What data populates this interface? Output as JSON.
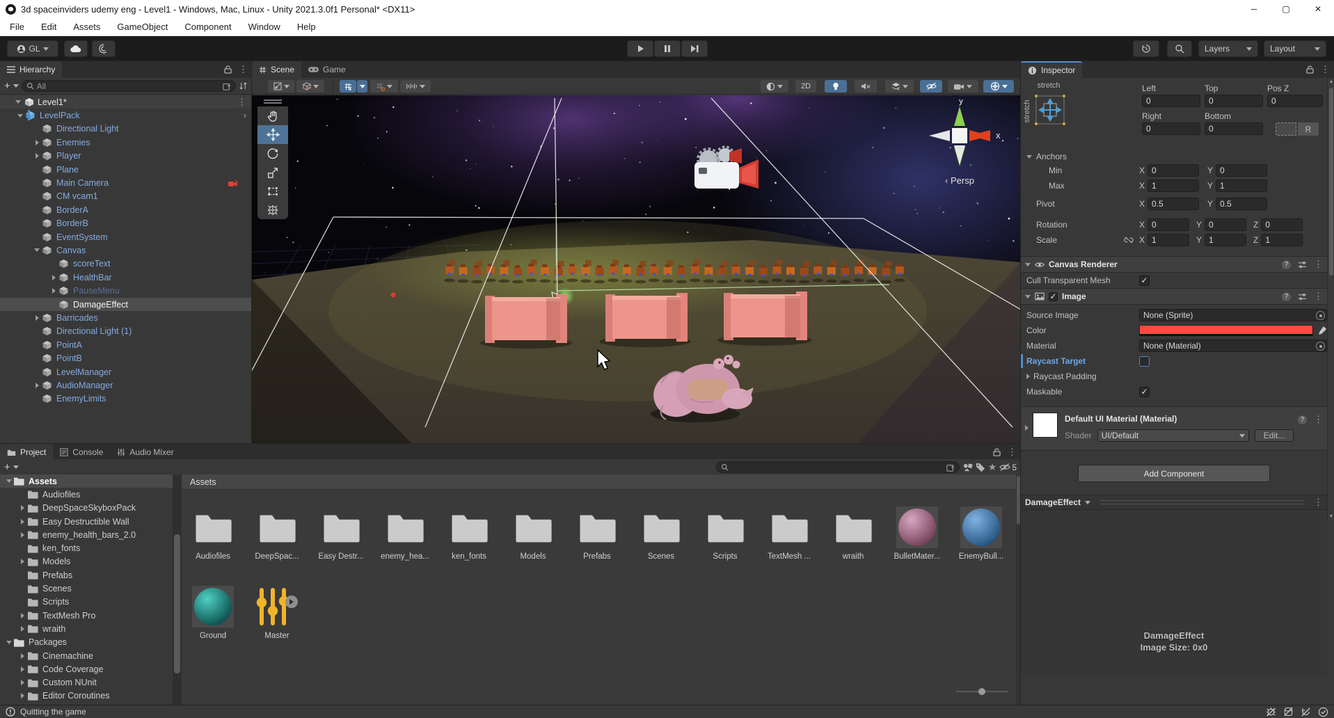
{
  "window": {
    "title": "3d spaceinviders udemy eng - Level1 - Windows, Mac, Linux - Unity 2021.3.0f1 Personal* <DX11>",
    "menu_items": [
      "File",
      "Edit",
      "Assets",
      "GameObject",
      "Component",
      "Window",
      "Help"
    ]
  },
  "toolbar": {
    "account_label": "GL",
    "layers_label": "Layers",
    "layout_label": "Layout"
  },
  "hierarchy": {
    "tab_label": "Hierarchy",
    "search_text": "All",
    "scene_label": "Level1*",
    "items": [
      {
        "label": "LevelPack",
        "depth": 1,
        "arrow": "down",
        "icon": "prefab",
        "chevron": true
      },
      {
        "label": "Directional Light",
        "depth": 2,
        "arrow": "none",
        "icon": "go"
      },
      {
        "label": "Enemies",
        "depth": 2,
        "arrow": "right",
        "icon": "go"
      },
      {
        "label": "Player",
        "depth": 2,
        "arrow": "right",
        "icon": "go"
      },
      {
        "label": "Plane",
        "depth": 2,
        "arrow": "none",
        "icon": "go"
      },
      {
        "label": "Main Camera",
        "depth": 2,
        "arrow": "none",
        "icon": "go",
        "badge": "camera-warning"
      },
      {
        "label": "CM vcam1",
        "depth": 2,
        "arrow": "none",
        "icon": "go"
      },
      {
        "label": "BorderA",
        "depth": 2,
        "arrow": "none",
        "icon": "go"
      },
      {
        "label": "BorderB",
        "depth": 2,
        "arrow": "none",
        "icon": "go"
      },
      {
        "label": "EventSystem",
        "depth": 2,
        "arrow": "none",
        "icon": "go"
      },
      {
        "label": "Canvas",
        "depth": 2,
        "arrow": "down",
        "icon": "go"
      },
      {
        "label": "scoreText",
        "depth": 3,
        "arrow": "none",
        "icon": "go"
      },
      {
        "label": "HealthBar",
        "depth": 3,
        "arrow": "right",
        "icon": "go"
      },
      {
        "label": "PauseMenu",
        "depth": 3,
        "arrow": "right",
        "icon": "go",
        "disabled": true
      },
      {
        "label": "DamageEffect",
        "depth": 3,
        "arrow": "none",
        "icon": "go",
        "selected": true
      },
      {
        "label": "Barricades",
        "depth": 2,
        "arrow": "right",
        "icon": "go"
      },
      {
        "label": "Directional Light (1)",
        "depth": 2,
        "arrow": "none",
        "icon": "go"
      },
      {
        "label": "PointA",
        "depth": 2,
        "arrow": "none",
        "icon": "go"
      },
      {
        "label": "PointB",
        "depth": 2,
        "arrow": "none",
        "icon": "go"
      },
      {
        "label": "LevelManager",
        "depth": 2,
        "arrow": "none",
        "icon": "go"
      },
      {
        "label": "AudioManager",
        "depth": 2,
        "arrow": "right",
        "icon": "go"
      },
      {
        "label": "EnemyLimits",
        "depth": 2,
        "arrow": "none",
        "icon": "go"
      }
    ]
  },
  "scene_view": {
    "scene_tab": "Scene",
    "game_tab": "Game",
    "toolbar": {
      "dim_label": "2D"
    },
    "gizmo": {
      "x_label": "x",
      "y_label": "y",
      "persp_label": "Persp"
    }
  },
  "inspector": {
    "tab_label": "Inspector",
    "rect_transform": {
      "stretch_h": "stretch",
      "stretch_v": "stretch",
      "left_label": "Left",
      "top_label": "Top",
      "posz_label": "Pos Z",
      "right_label": "Right",
      "bottom_label": "Bottom",
      "left": "0",
      "top": "0",
      "posz": "0",
      "right": "0",
      "bottom": "0",
      "r_button": "R",
      "anchors_label": "Anchors",
      "min_label": "Min",
      "max_label": "Max",
      "min_x": "0",
      "min_y": "0",
      "max_x": "1",
      "max_y": "1",
      "pivot_label": "Pivot",
      "pivot_x": "0.5",
      "pivot_y": "0.5",
      "rotation_label": "Rotation",
      "rot_x": "0",
      "rot_y": "0",
      "rot_z": "0",
      "scale_label": "Scale",
      "scale_x": "1",
      "scale_y": "1",
      "scale_z": "1",
      "x_label": "X",
      "y_label": "Y",
      "z_label": "Z"
    },
    "canvas_renderer": {
      "title": "Canvas Renderer",
      "cull_label": "Cull Transparent Mesh",
      "cull_checked": "✓"
    },
    "image": {
      "title": "Image",
      "source_image_label": "Source Image",
      "source_image_value": "None (Sprite)",
      "color_label": "Color",
      "color_value": "#FF4B40",
      "material_label": "Material",
      "material_value": "None (Material)",
      "raycast_target_label": "Raycast Target",
      "raycast_padding_label": "Raycast Padding",
      "maskable_label": "Maskable",
      "maskable_checked": "✓"
    },
    "default_material": {
      "title": "Default UI Material (Material)",
      "shader_label": "Shader",
      "shader_value": "UI/Default",
      "edit_button": "Edit..."
    },
    "add_component_button": "Add Component",
    "preview": {
      "header": "DamageEffect",
      "name": "DamageEffect",
      "size_text": "Image Size: 0x0"
    }
  },
  "project": {
    "tabs": [
      "Project",
      "Console",
      "Audio Mixer"
    ],
    "breadcrumb": "Assets",
    "hidden_count": "5",
    "tree": [
      {
        "label": "Assets",
        "depth": 0,
        "arrow": "down",
        "open": true,
        "selected": true
      },
      {
        "label": "Audiofiles",
        "depth": 1,
        "arrow": "none"
      },
      {
        "label": "DeepSpaceSkyboxPack",
        "depth": 1,
        "arrow": "right"
      },
      {
        "label": "Easy Destructible Wall",
        "depth": 1,
        "arrow": "right"
      },
      {
        "label": "enemy_health_bars_2.0",
        "depth": 1,
        "arrow": "right"
      },
      {
        "label": "ken_fonts",
        "depth": 1,
        "arrow": "none"
      },
      {
        "label": "Models",
        "depth": 1,
        "arrow": "right"
      },
      {
        "label": "Prefabs",
        "depth": 1,
        "arrow": "none"
      },
      {
        "label": "Scenes",
        "depth": 1,
        "arrow": "none"
      },
      {
        "label": "Scripts",
        "depth": 1,
        "arrow": "none"
      },
      {
        "label": "TextMesh Pro",
        "depth": 1,
        "arrow": "right"
      },
      {
        "label": "wraith",
        "depth": 1,
        "arrow": "right"
      },
      {
        "label": "Packages",
        "depth": 0,
        "arrow": "down",
        "open": true
      },
      {
        "label": "Cinemachine",
        "depth": 1,
        "arrow": "right"
      },
      {
        "label": "Code Coverage",
        "depth": 1,
        "arrow": "right"
      },
      {
        "label": "Custom NUnit",
        "depth": 1,
        "arrow": "right"
      },
      {
        "label": "Editor Coroutines",
        "depth": 1,
        "arrow": "right"
      }
    ],
    "assets": [
      {
        "label": "Audiofiles",
        "type": "folder"
      },
      {
        "label": "DeepSpac...",
        "type": "folder"
      },
      {
        "label": "Easy Destr...",
        "type": "folder"
      },
      {
        "label": "enemy_hea...",
        "type": "folder"
      },
      {
        "label": "ken_fonts",
        "type": "folder"
      },
      {
        "label": "Models",
        "type": "folder"
      },
      {
        "label": "Prefabs",
        "type": "folder"
      },
      {
        "label": "Scenes",
        "type": "folder"
      },
      {
        "label": "Scripts",
        "type": "folder"
      },
      {
        "label": "TextMesh ...",
        "type": "folder"
      },
      {
        "label": "wraith",
        "type": "folder"
      },
      {
        "label": "BulletMater...",
        "type": "material",
        "c1": "#d7a6c0",
        "c2": "#7e4a63"
      },
      {
        "label": "EnemyBull...",
        "type": "material",
        "c1": "#7fb3e0",
        "c2": "#2e5d8a"
      },
      {
        "label": "Ground",
        "type": "material",
        "c1": "#4ed0c4",
        "c2": "#135c58"
      },
      {
        "label": "Master",
        "type": "mixer"
      }
    ]
  },
  "status_bar": {
    "message": "Quitting the game"
  }
}
